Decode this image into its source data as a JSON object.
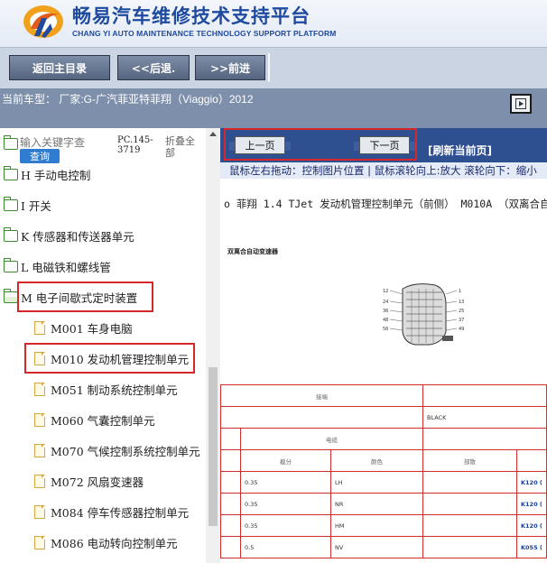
{
  "header": {
    "title": "畅易汽车维修技术支持平台",
    "subtitle": "CHANG YI AUTO MAINTENANCE TECHNOLOGY SUPPORT PLATFORM",
    "logo_icon": "swirl-logo-icon"
  },
  "toolbar": {
    "home_label": "返回主目录",
    "back_label": "<<后退.",
    "forward_label": ">>前进"
  },
  "vehicle": {
    "text": "当前车型： 厂家:G-广汽菲亚特菲翔（Viaggio）2012"
  },
  "left_panel": {
    "search_placeholder": "输入关键字查",
    "search_button": "查询",
    "pc_code": "PC.145-3719",
    "collapse_all": "折叠全部",
    "tree": [
      {
        "label": "H 手动电控制",
        "level": 1,
        "icon": "folder-icon"
      },
      {
        "label": "I 开关",
        "level": 1,
        "icon": "folder-icon"
      },
      {
        "label": "K 传感器和传送器单元",
        "level": 1,
        "icon": "folder-icon"
      },
      {
        "label": "L 电磁铁和螺线管",
        "level": 1,
        "icon": "folder-icon"
      },
      {
        "label": "M 电子间歇式定时装置",
        "level": 1,
        "icon": "folder-open-icon",
        "highlighted": true
      },
      {
        "label": "M001 车身电脑",
        "level": 2,
        "icon": "document-icon"
      },
      {
        "label": "M010 发动机管理控制单元",
        "level": 2,
        "icon": "document-icon",
        "highlighted": true
      },
      {
        "label": "M051 制动系统控制单元",
        "level": 2,
        "icon": "document-icon"
      },
      {
        "label": "M060 气囊控制单元",
        "level": 2,
        "icon": "document-icon"
      },
      {
        "label": "M070 气候控制系统控制单元",
        "level": 2,
        "icon": "document-icon"
      },
      {
        "label": "M072 风扇变速器",
        "level": 2,
        "icon": "document-icon"
      },
      {
        "label": "M084 停车传感器控制单元",
        "level": 2,
        "icon": "document-icon"
      },
      {
        "label": "M086 电动转向控制单元",
        "level": 2,
        "icon": "document-icon"
      }
    ]
  },
  "right_panel": {
    "prev_label": "上一页",
    "next_label": "下一页",
    "refresh_label": "[刷新当前页]",
    "hint": "鼠标左右拖动：控制图片位置 | 鼠标滚轮向上:放大  滚轮向下：缩小",
    "doc_title": "o 菲翔  1.4 TJet  发动机管理控制单元（前侧） M010A （双离合自",
    "doc_subtitle": "双离合自动变速器",
    "diagram_pins_left": [
      "12",
      "24",
      "36",
      "48",
      "56"
    ],
    "diagram_pins_right": [
      "1",
      "13",
      "25",
      "37",
      "49"
    ],
    "table": {
      "header_top_left": "接端",
      "header_color": "BLACK",
      "header_mid": "电缆",
      "col_headers": [
        "截分",
        "颜色",
        "部散"
      ],
      "rows": [
        {
          "size": "0.35",
          "color": "LH",
          "code": "K120 ("
        },
        {
          "size": "0.35",
          "color": "NR",
          "code": "K120 ("
        },
        {
          "size": "0.35",
          "color": "HM",
          "code": "K120 ("
        },
        {
          "size": "0.5",
          "color": "NV",
          "code": "K055 ("
        }
      ]
    }
  }
}
